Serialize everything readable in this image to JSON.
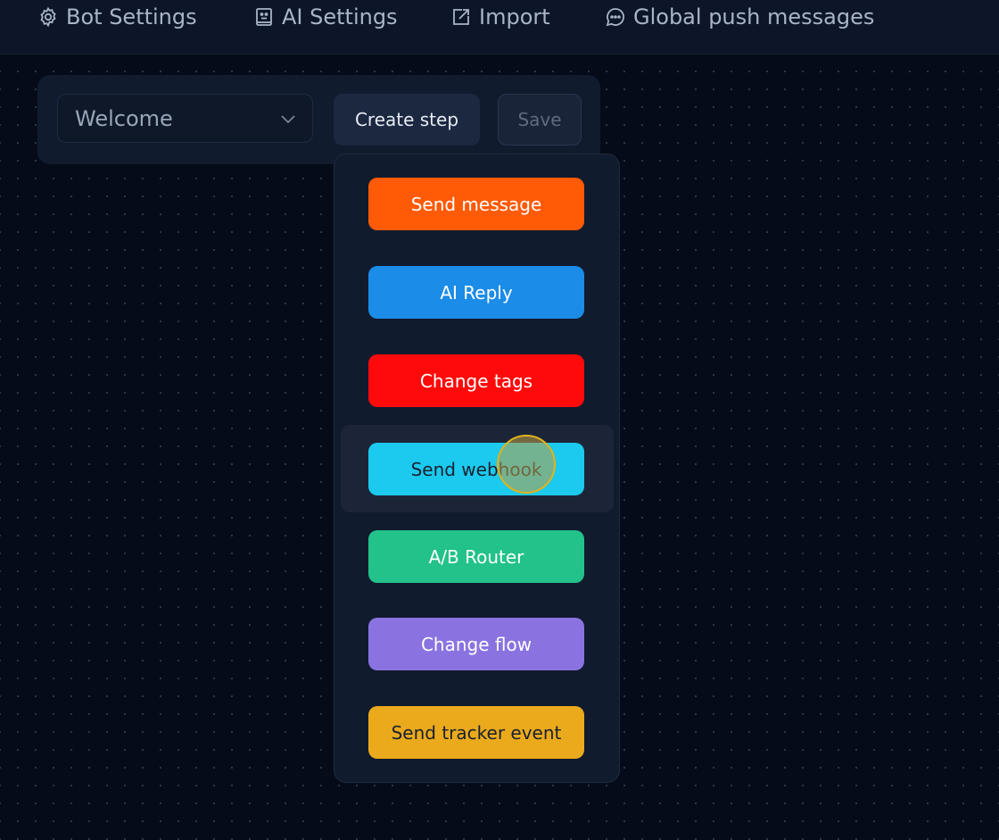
{
  "nav": {
    "items": [
      {
        "label": "Bot Settings",
        "icon": "gear-icon"
      },
      {
        "label": "AI Settings",
        "icon": "ai-bot-icon"
      },
      {
        "label": "Import",
        "icon": "import-icon"
      },
      {
        "label": "Global push messages",
        "icon": "chat-bubble-icon"
      }
    ]
  },
  "toolbar": {
    "flow_select": {
      "value": "Welcome"
    },
    "create_step_label": "Create step",
    "save_label": "Save"
  },
  "step_menu": {
    "items": [
      {
        "label": "Send message",
        "color": "#ff5a06"
      },
      {
        "label": "AI Reply",
        "color": "#1b8ce8"
      },
      {
        "label": "Change tags",
        "color": "#ff0a0a"
      },
      {
        "label": "Send webhook",
        "color": "#1bcaee"
      },
      {
        "label": "A/B Router",
        "color": "#22c28a"
      },
      {
        "label": "Change flow",
        "color": "#8a73e0"
      },
      {
        "label": "Send tracker event",
        "color": "#eaaa1c"
      }
    ],
    "hovered_item": "Send webhook"
  },
  "colors": {
    "background": "#050b18",
    "panel": "#111b2e",
    "cursor_highlight": "#e3b21a"
  }
}
